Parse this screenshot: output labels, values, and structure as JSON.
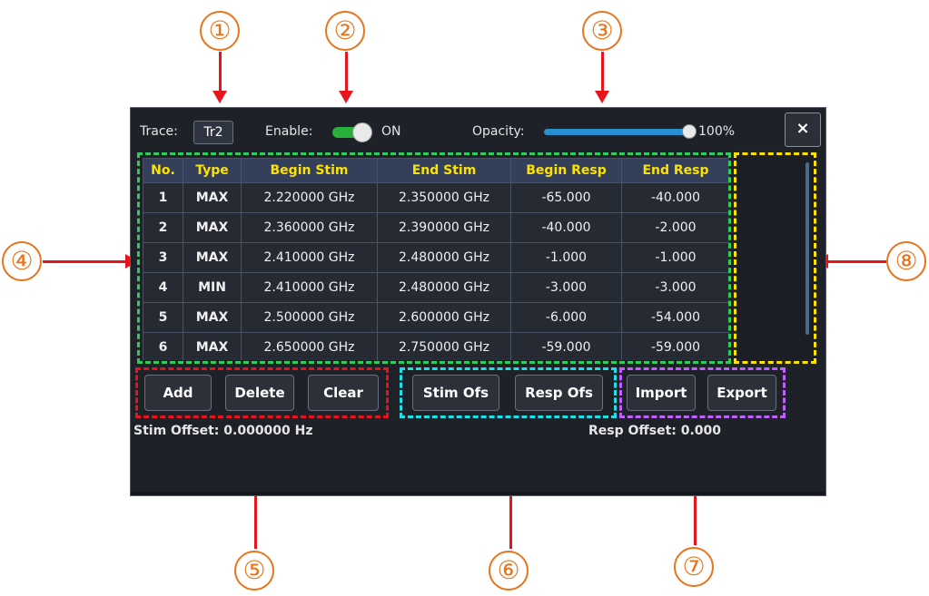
{
  "callouts": [
    "①",
    "②",
    "③",
    "④",
    "⑤",
    "⑥",
    "⑦",
    "⑧"
  ],
  "header": {
    "trace_label": "Trace:",
    "trace_value": "Tr2",
    "enable_label": "Enable:",
    "enable_state": "ON",
    "opacity_label": "Opacity:",
    "opacity_value": "100%",
    "opacity_level": 1.0,
    "close_label": "×"
  },
  "table": {
    "columns": [
      "No.",
      "Type",
      "Begin Stim",
      "End Stim",
      "Begin Resp",
      "End Resp"
    ],
    "rows": [
      [
        "1",
        "MAX",
        "2.220000 GHz",
        "2.350000 GHz",
        "-65.000",
        "-40.000"
      ],
      [
        "2",
        "MAX",
        "2.360000 GHz",
        "2.390000 GHz",
        "-40.000",
        "-2.000"
      ],
      [
        "3",
        "MAX",
        "2.410000 GHz",
        "2.480000 GHz",
        "-1.000",
        "-1.000"
      ],
      [
        "4",
        "MIN",
        "2.410000 GHz",
        "2.480000 GHz",
        "-3.000",
        "-3.000"
      ],
      [
        "5",
        "MAX",
        "2.500000 GHz",
        "2.600000 GHz",
        "-6.000",
        "-54.000"
      ],
      [
        "6",
        "MAX",
        "2.650000 GHz",
        "2.750000 GHz",
        "-59.000",
        "-59.000"
      ]
    ]
  },
  "buttons": {
    "add": "Add",
    "delete": "Delete",
    "clear": "Clear",
    "stim_ofs": "Stim Ofs",
    "resp_ofs": "Resp Ofs",
    "import": "Import",
    "export": "Export"
  },
  "status": {
    "stim_offset": "Stim Offset: 0.000000 Hz",
    "resp_offset": "Resp Offset: 0.000"
  },
  "colors": {
    "callout": "#e8741c",
    "arrow": "#e8141c",
    "table_box": "#2fcc5a",
    "edit_buttons_box": "#e8141c",
    "offset_buttons_box": "#1ee0e8",
    "file_buttons_box": "#c060ff",
    "scroll_box": "#ffe100",
    "header_text": "#ffe100",
    "toggle_on": "#27b13a",
    "slider": "#2a8fd0"
  },
  "icons": {
    "close": "close-icon"
  }
}
